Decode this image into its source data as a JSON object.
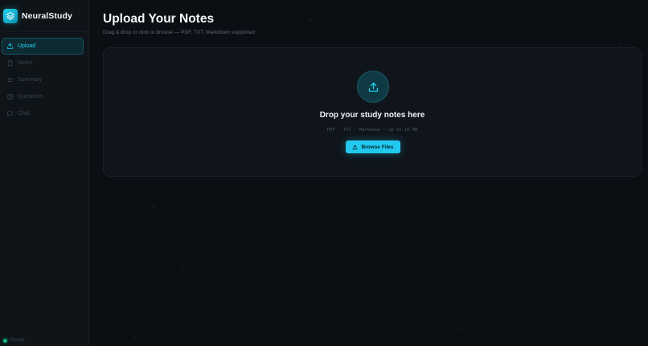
{
  "app": {
    "name": "NeuralStudy",
    "logo_icon": "layers-icon",
    "accent": "#22d3ee"
  },
  "sidebar": {
    "items": [
      {
        "label": "Upload",
        "icon": "upload-icon",
        "active": true
      },
      {
        "label": "Notes",
        "icon": "file-icon",
        "active": false
      },
      {
        "label": "Summary",
        "icon": "list-icon",
        "active": false
      },
      {
        "label": "Questions",
        "icon": "help-circle-icon",
        "active": false
      },
      {
        "label": "Chat",
        "icon": "chat-icon",
        "active": false
      }
    ],
    "status": {
      "label": "Ready",
      "color": "#10b981"
    }
  },
  "main": {
    "title": "Upload Your Notes",
    "subtitle": "Drag & drop or click to browse — PDF, TXT, Markdown supported",
    "dropzone": {
      "icon": "upload-icon",
      "title": "Drop your study notes here",
      "hint": "PDF · TXT · Markdown — up to 10 MB",
      "browse_label": "Browse Files",
      "browse_icon": "upload-icon"
    }
  }
}
